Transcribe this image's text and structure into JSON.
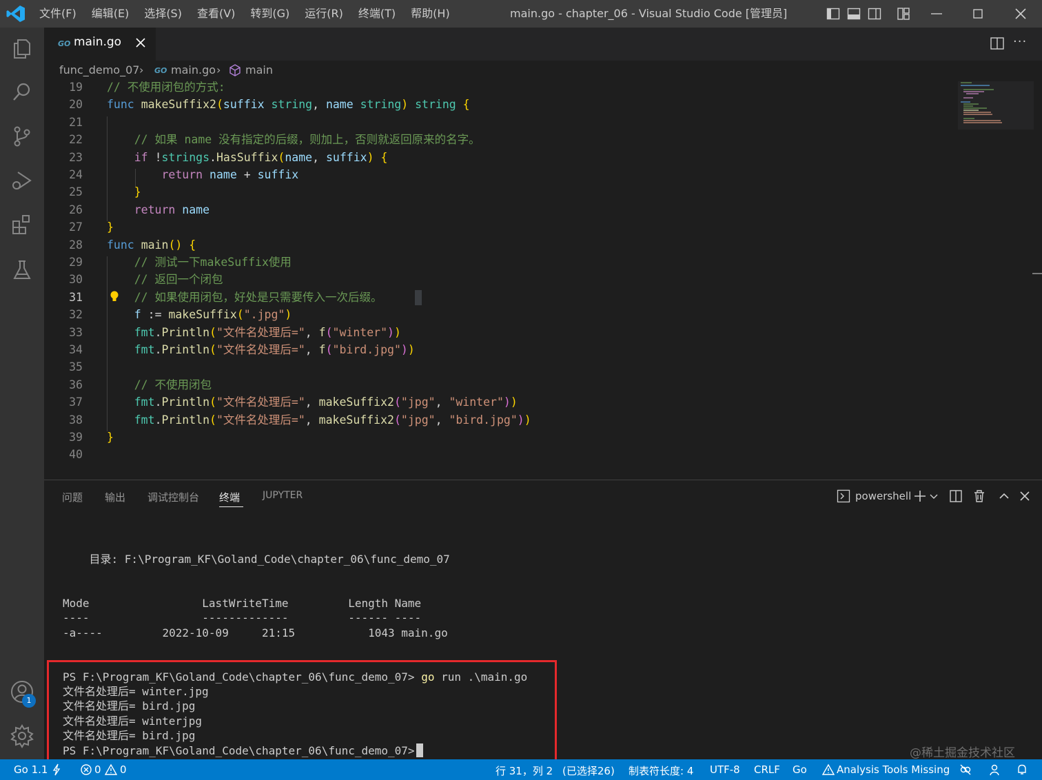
{
  "titlebar": {
    "menu": [
      "文件(F)",
      "编辑(E)",
      "选择(S)",
      "查看(V)",
      "转到(G)",
      "运行(R)",
      "终端(T)",
      "帮助(H)"
    ],
    "title": "main.go - chapter_06 - Visual Studio Code [管理员]"
  },
  "tab": {
    "label": "main.go",
    "go_badge": "GO"
  },
  "breadcrumb": {
    "folder": "func_demo_07",
    "file": "main.go",
    "symbol": "main"
  },
  "editor": {
    "active_line": "31",
    "lines": [
      {
        "n": "19",
        "t": "// 不使用闭包的方式:"
      },
      {
        "n": "20",
        "t": "func makeSuffix2(suffix string, name string) string {"
      },
      {
        "n": "21",
        "t": ""
      },
      {
        "n": "22",
        "t": "    // 如果 name 没有指定的后缀，则加上，否则就返回原来的名字。"
      },
      {
        "n": "23",
        "t": "    if !strings.HasSuffix(name, suffix) {"
      },
      {
        "n": "24",
        "t": "        return name + suffix"
      },
      {
        "n": "25",
        "t": "    }"
      },
      {
        "n": "26",
        "t": "    return name"
      },
      {
        "n": "27",
        "t": "}"
      },
      {
        "n": "28",
        "t": "func main() {"
      },
      {
        "n": "29",
        "t": "    // 测试一下makeSuffix使用"
      },
      {
        "n": "30",
        "t": "    // 返回一个闭包"
      },
      {
        "n": "31",
        "t": "    // 如果使用闭包，好处是只需要传入一次后缀。"
      },
      {
        "n": "32",
        "t": "    f := makeSuffix(\".jpg\")"
      },
      {
        "n": "33",
        "t": "    fmt.Println(\"文件名处理后=\", f(\"winter\"))"
      },
      {
        "n": "34",
        "t": "    fmt.Println(\"文件名处理后=\", f(\"bird.jpg\"))"
      },
      {
        "n": "35",
        "t": ""
      },
      {
        "n": "36",
        "t": "    // 不使用闭包"
      },
      {
        "n": "37",
        "t": "    fmt.Println(\"文件名处理后=\", makeSuffix2(\"jpg\", \"winter\"))"
      },
      {
        "n": "38",
        "t": "    fmt.Println(\"文件名处理后=\", makeSuffix2(\"jpg\", \"bird.jpg\"))"
      },
      {
        "n": "39",
        "t": "}"
      },
      {
        "n": "40",
        "t": ""
      }
    ]
  },
  "panel": {
    "tabs": [
      "问题",
      "输出",
      "调试控制台",
      "终端",
      "JUPYTER"
    ],
    "active_tab": "终端",
    "shell": "powershell",
    "terminal": {
      "dir_line": "    目录: F:\\Program_KF\\Goland_Code\\chapter_06\\func_demo_07",
      "header": "Mode                 LastWriteTime         Length Name",
      "separator": "----                 -------------         ------ ----",
      "file_row": "-a----         2022-10-09     21:15           1043 main.go",
      "prompt": "PS F:\\Program_KF\\Goland_Code\\chapter_06\\func_demo_07>",
      "command_go": "go",
      "command_rest": " run .\\main.go",
      "outputs": [
        "文件名处理后= winter.jpg",
        "文件名处理后= bird.jpg",
        "文件名处理后= winterjpg",
        "文件名处理后= bird.jpg"
      ]
    }
  },
  "accounts_badge": "1",
  "watermark": "@稀土掘金技术社区",
  "statusbar": {
    "go_version": "Go 1.1",
    "errors": "0",
    "warnings": "0",
    "position": "行 31，列 2",
    "selection": "(已选择26)",
    "tab_size": "制表符长度: 4",
    "encoding": "UTF-8",
    "eol": "CRLF",
    "language": "Go",
    "analysis": "Analysis Tools Missing"
  },
  "colors": {
    "accent": "#007acc",
    "highlight_box": "#e5292c",
    "keyword": "#569cd6",
    "string": "#ce9178",
    "comment": "#6a9955",
    "function": "#dcdcaa"
  }
}
